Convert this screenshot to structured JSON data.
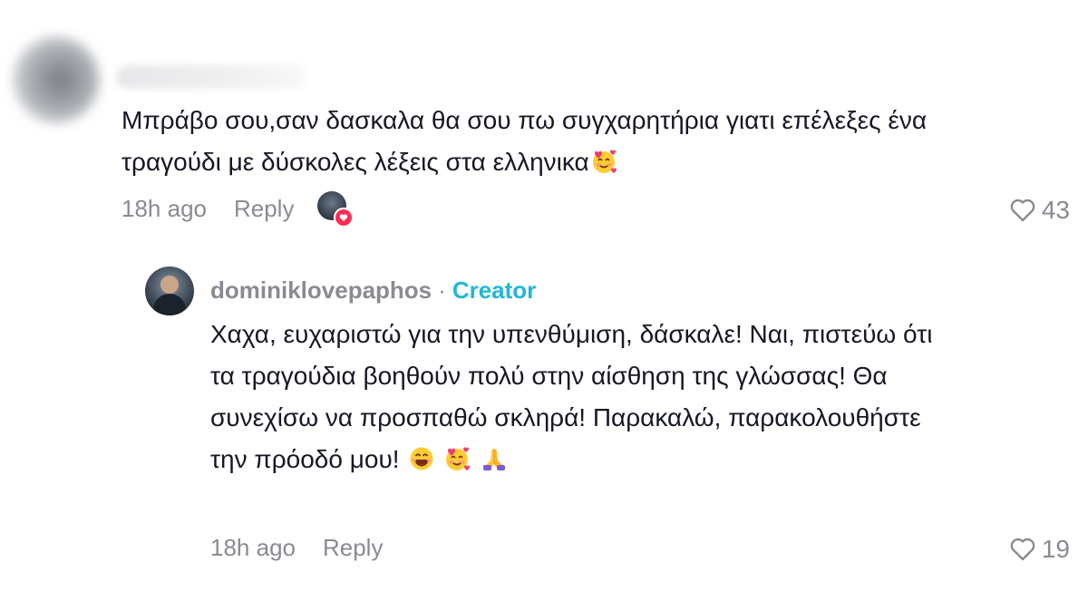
{
  "comment": {
    "text": "Μπράβο σου,σαν δασκαλα θα σου πω συγχαρητήρια γιατι επέλεξες ένα τραγούδι με δύσκολες λέξεις στα ελληνικα",
    "time": "18h ago",
    "reply_label": "Reply",
    "like_count": "43"
  },
  "reply": {
    "username": "dominiklovepaphos",
    "separator": "·",
    "badge": "Creator",
    "text": "Χαχα, ευχαριστώ για την υπενθύμιση, δάσκαλε! Ναι, πιστεύω ότι τα τραγούδια βοηθούν πολύ στην αίσθηση της γλώσσας! Θα συνεχίσω να προσπαθώ σκληρά! Παρακαλώ, παρακολουθήστε την πρόοδό μου!",
    "time": "18h ago",
    "reply_label": "Reply",
    "like_count": "19"
  },
  "icons": {
    "heart": "heart-outline-icon",
    "smiling_hearts": "smiling-face-with-hearts-emoji",
    "grinning": "grinning-face-emoji",
    "folded_hands": "folded-hands-emoji",
    "creator_liked": "creator-liked-heart-icon"
  },
  "colors": {
    "text": "#161823",
    "muted": "#8a8b91",
    "creator": "#20b8d4",
    "like_badge": "#fe2c55"
  }
}
